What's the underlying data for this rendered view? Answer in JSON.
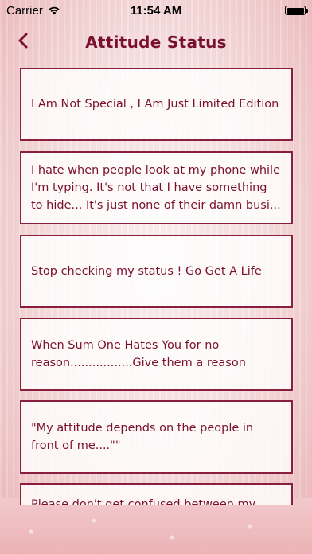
{
  "status_bar": {
    "carrier": "Carrier",
    "time": "11:54 AM",
    "icons": [
      "wifi-icon",
      "battery-icon"
    ]
  },
  "nav": {
    "back_icon": "chevron-left-icon",
    "title": "Attitude Status"
  },
  "colors": {
    "accent": "#7a1030",
    "card_border": "#8a1e3e",
    "background": "#f6e3e3"
  },
  "statuses": [
    {
      "text": "I Am Not Special , I Am Just Limited Edition"
    },
    {
      "text": "I hate when people look at my phone while I'm typing. It's not that I have something to hide... It's just none of their damn busi..."
    },
    {
      "text": "Stop checking my status ! Go Get A Life"
    },
    {
      "text": "When Sum One Hates You for no reason.................Give them a reason"
    },
    {
      "text": "\"My attitude depends on the people in front of me....\"\""
    },
    {
      "text": "Please don't get confused between my"
    }
  ]
}
